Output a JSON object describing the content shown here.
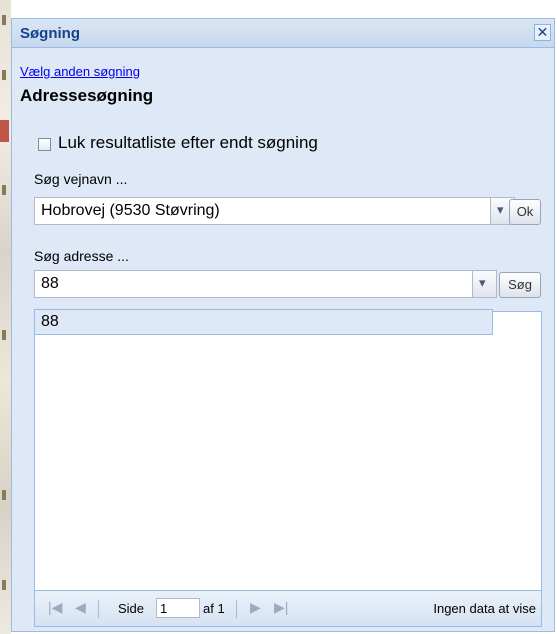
{
  "window": {
    "title": "Søgning"
  },
  "switch_search_link": "Vælg anden søgning",
  "heading": "Adressesøgning",
  "close_results_checkbox": {
    "label": "Luk resultatliste efter endt søgning",
    "checked": false
  },
  "street_search": {
    "label": "Søg vejnavn ...",
    "value": "Hobrovej (9530 Støvring)",
    "button_label": "Ok"
  },
  "address_search": {
    "label": "Søg adresse ...",
    "value": "88",
    "button_label": "Søg"
  },
  "address_suggestions": [
    "88"
  ],
  "pager": {
    "page_label": "Side",
    "page_value": "1",
    "of_label": "af 1",
    "status": "Ingen data at vise"
  },
  "icons": {
    "close": "close-icon",
    "first": "first-page-icon",
    "prev": "prev-page-icon",
    "next": "next-page-icon",
    "last": "last-page-icon",
    "dropdown": "chevron-down-icon"
  }
}
